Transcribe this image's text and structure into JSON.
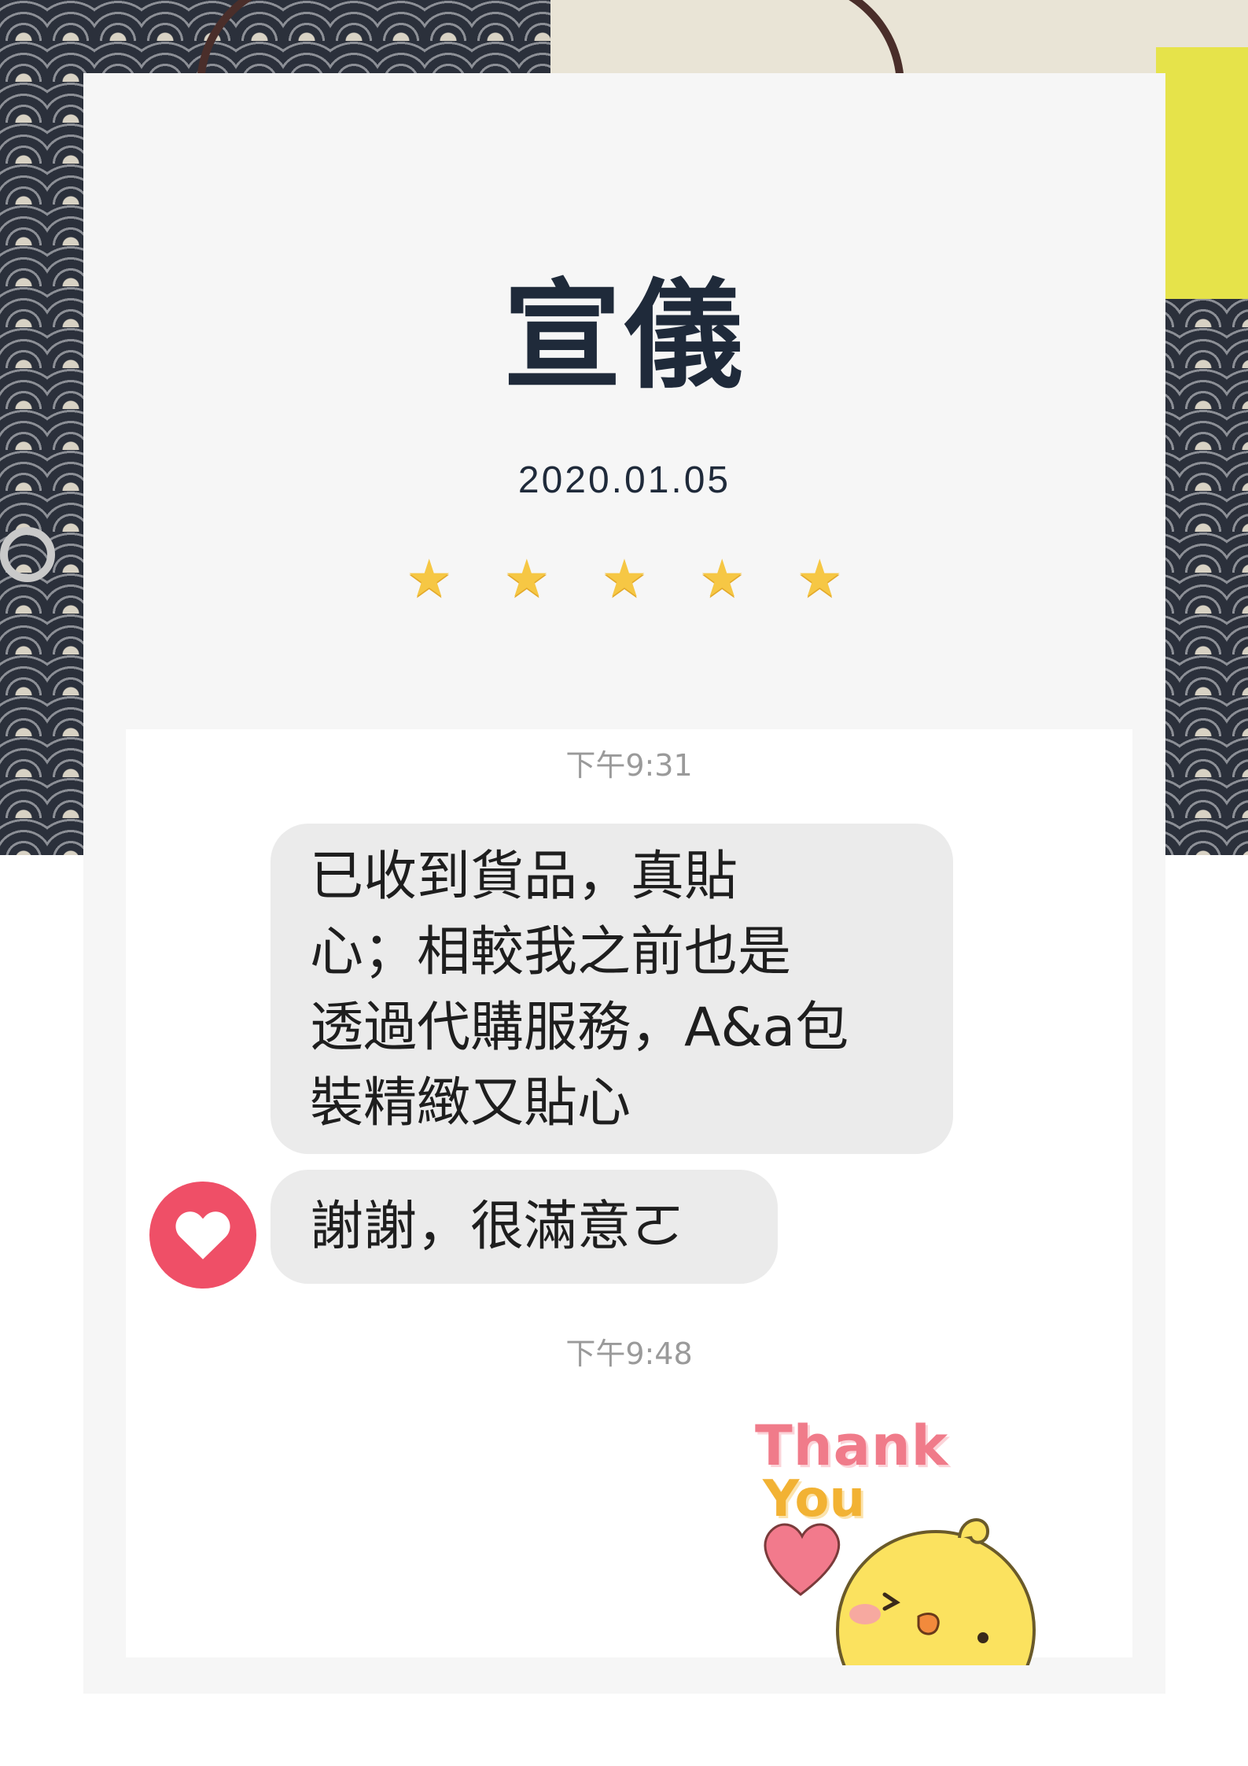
{
  "review": {
    "name": "宣儀",
    "date": "2020.01.05",
    "rating": 5,
    "star_icon": "star-icon",
    "star_color": "#f6c744"
  },
  "chat": {
    "timestamp_1": "下午9:31",
    "message_1_lines": [
      "已收到貨品，真貼",
      "心；相較我之前也是",
      "透過代購服務，A&a包",
      "裝精緻又貼心"
    ],
    "message_2": "謝謝，很滿意ㄛ",
    "reaction_icon": "heart-icon",
    "reaction_color": "#ef4f67",
    "timestamp_2": "下午9:48",
    "sticker": {
      "line_1": "Thank",
      "line_2": "You"
    }
  }
}
